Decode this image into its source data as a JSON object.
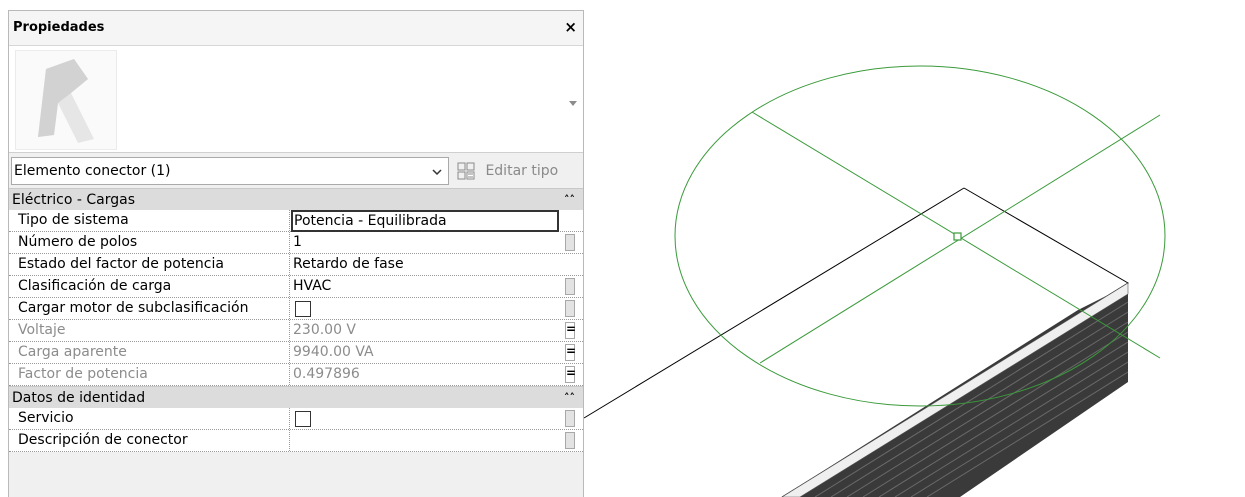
{
  "palette": {
    "title": "Propiedades",
    "close_glyph": "×",
    "type_selector": "Elemento conector (1)",
    "edit_type_label": "Editar tipo"
  },
  "groups": [
    {
      "label": "Eléctrico - Cargas",
      "collapse_glyph": "˄˄",
      "rows": [
        {
          "name": "Tipo de sistema",
          "value": "Potencia - Equilibrada",
          "editing": true,
          "disabled": false,
          "control": "none"
        },
        {
          "name": "Número de polos",
          "value": "1",
          "disabled": false,
          "control": "button"
        },
        {
          "name": "Estado del factor de potencia",
          "value": "Retardo de fase",
          "disabled": false,
          "control": "none"
        },
        {
          "name": "Clasificación de carga",
          "value": "HVAC",
          "disabled": false,
          "control": "button"
        },
        {
          "name": "Cargar motor de subclasificación",
          "value": "",
          "checkbox": true,
          "disabled": false,
          "control": "button"
        },
        {
          "name": "Voltaje",
          "value": "230.00 V",
          "disabled": true,
          "control": "eq"
        },
        {
          "name": "Carga aparente",
          "value": "9940.00 VA",
          "disabled": true,
          "control": "eq"
        },
        {
          "name": "Factor de potencia",
          "value": "0.497896",
          "disabled": true,
          "control": "eq"
        }
      ]
    },
    {
      "label": "Datos de identidad",
      "collapse_glyph": "˄˄",
      "rows": [
        {
          "name": "Servicio",
          "value": "",
          "checkbox": true,
          "disabled": false,
          "control": "button"
        },
        {
          "name": "Descripción de conector",
          "value": "",
          "disabled": false,
          "control": "button"
        }
      ]
    }
  ],
  "colors": {
    "circle": "#3a9a3a",
    "model_edge": "#000000",
    "front_face": "#3a3a3a"
  }
}
